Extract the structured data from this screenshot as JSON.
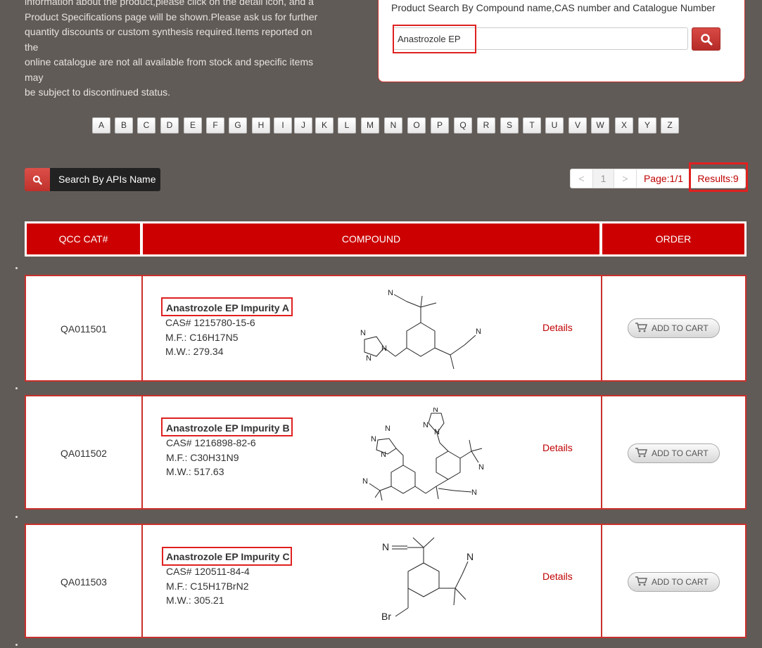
{
  "intro_lines": [
    "information about the product,please click on the detail icon, and a",
    "Product Specifications page will be shown.Please ask us for further",
    "quantity discounts or custom synthesis required.Items reported on the",
    "online catalogue are not all available from stock and specific items may",
    "be subject to discontinued status."
  ],
  "search": {
    "label": "Product Search By Compound name,CAS number and Catalogue Number",
    "value": "Anastrozole EP",
    "button_icon": "search-icon"
  },
  "alphabet": [
    "A",
    "B",
    "C",
    "D",
    "E",
    "F",
    "G",
    "H",
    "I",
    "J",
    "K",
    "L",
    "M",
    "N",
    "O",
    "P",
    "Q",
    "R",
    "S",
    "T",
    "U",
    "V",
    "W",
    "X",
    "Y",
    "Z"
  ],
  "apis_button": {
    "label": "Search By APIs Name",
    "icon": "search-icon"
  },
  "pager": {
    "prev": "<",
    "page": "1",
    "next": ">",
    "page_info": "Page:1/1",
    "results": "Results:9"
  },
  "table": {
    "headers": [
      "QCC CAT#",
      "COMPOUND",
      "ORDER"
    ],
    "details_label": "Details",
    "cart_label": "ADD TO CART",
    "rows": [
      {
        "cat": "QA011501",
        "name": "Anastrozole EP Impurity A",
        "cas": "CAS# 1215780-15-6",
        "mf": "M.F.: C16H17N5",
        "mw": "M.W.: 279.34"
      },
      {
        "cat": "QA011502",
        "name": "Anastrozole EP Impurity B",
        "cas": "CAS# 1216898-82-6",
        "mf": "M.F.: C30H31N9",
        "mw": "M.W.: 517.63"
      },
      {
        "cat": "QA011503",
        "name": "Anastrozole EP Impurity C",
        "cas": "CAS# 120511-84-4",
        "mf": "M.F.: C15H17BrN2",
        "mw": "M.W.: 305.21"
      }
    ]
  },
  "colors": {
    "background": "#615b57",
    "accent": "#cc0000",
    "highlight": "#e02020"
  }
}
